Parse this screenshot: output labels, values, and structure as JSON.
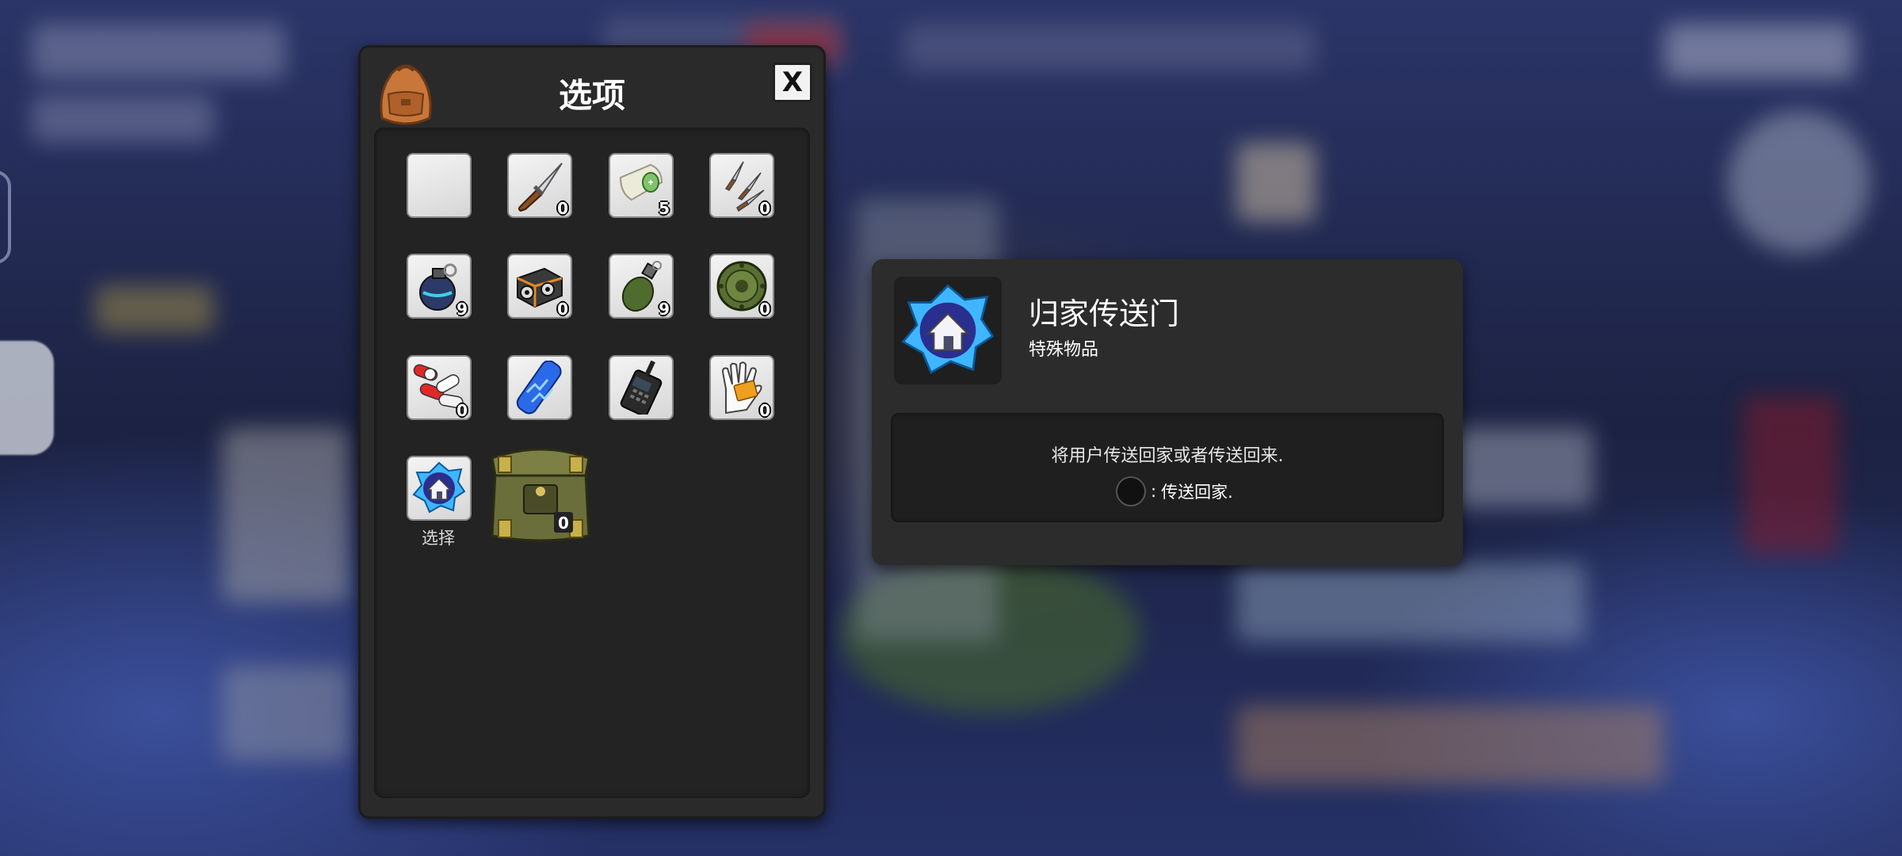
{
  "inventory": {
    "title": "选项",
    "close_label": "X",
    "items": [
      {
        "icon": "empty-slot",
        "count": ""
      },
      {
        "icon": "knife-icon",
        "count": "0"
      },
      {
        "icon": "bandage-icon",
        "count": "5"
      },
      {
        "icon": "throwing-knives-icon",
        "count": "0"
      },
      {
        "icon": "frag-grenade-icon",
        "count": "9"
      },
      {
        "icon": "turret-device-icon",
        "count": "0"
      },
      {
        "icon": "green-grenade-icon",
        "count": "9"
      },
      {
        "icon": "landmine-icon",
        "count": "0"
      },
      {
        "icon": "pills-icon",
        "count": "0"
      },
      {
        "icon": "energy-cell-icon",
        "count": ""
      },
      {
        "icon": "walkie-talkie-icon",
        "count": ""
      },
      {
        "icon": "hand-card-icon",
        "count": "0"
      },
      {
        "icon": "home-portal-icon",
        "count": "",
        "selected_label": "选择"
      }
    ],
    "crate_count": "0"
  },
  "detail": {
    "title": "归家传送门",
    "subtitle": "特殊物品",
    "description": "将用户传送回家或者传送回来.",
    "action_separator": ":",
    "action_label": "传送回家."
  },
  "colors": {
    "panel": "#2a2a2a",
    "inner": "#232323",
    "accent_red": "#e02020"
  }
}
